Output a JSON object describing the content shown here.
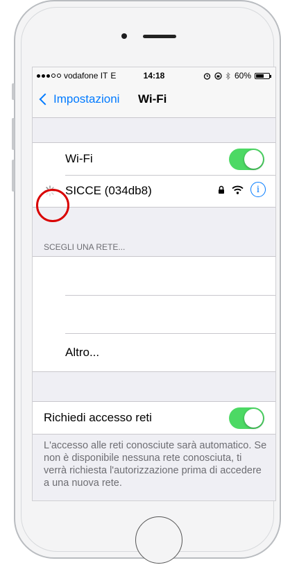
{
  "statusbar": {
    "carrier": "vodafone IT",
    "network": "E",
    "time": "14:18",
    "battery": "60%",
    "battery_level": 0.6
  },
  "navbar": {
    "back_label": "Impostazioni",
    "title": "Wi-Fi"
  },
  "wifi_group": {
    "wifi_label": "Wi-Fi",
    "wifi_on": true,
    "network_name": "SICCE (034db8)"
  },
  "choose_network": {
    "header": "SCEGLI UNA RETE...",
    "other_label": "Altro..."
  },
  "ask_join": {
    "label": "Richiedi accesso reti",
    "on": true,
    "footer": "L'accesso alle reti conosciute sarà automatico. Se non è disponibile nessuna rete conosciuta, ti verrà richiesta l'autorizzazione prima di accedere a una nuova rete."
  },
  "colors": {
    "accent": "#007aff",
    "toggle_on": "#4cd964",
    "highlight_ring": "#d90000"
  },
  "icons": [
    "signal-dots-icon",
    "alarm-icon",
    "orientation-lock-icon",
    "bluetooth-icon",
    "battery-icon",
    "chevron-left-icon",
    "spinner-icon",
    "lock-icon",
    "wifi-signal-icon",
    "info-icon"
  ]
}
